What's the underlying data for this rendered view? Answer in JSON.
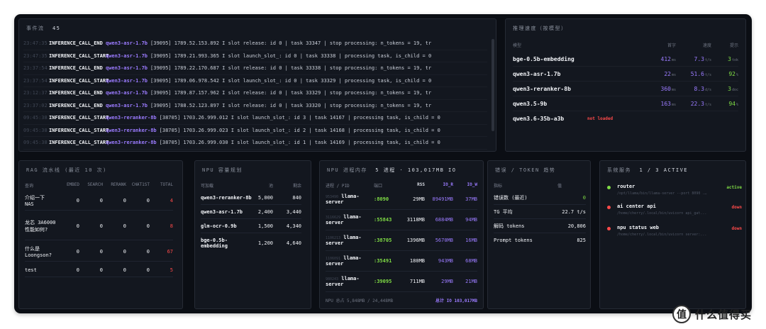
{
  "event_log": {
    "title": "事件流",
    "count": "45",
    "rows": [
      {
        "time": "23:47:35",
        "type": "INFERENCE_CALL_END",
        "model": "qwen3-asr-1.7b",
        "msg": "[39095] 1789.52.153.892 I slot release: id 0 | task 33347 | stop processing: n_tokens = 19, tr"
      },
      {
        "time": "23:47:35",
        "type": "INFERENCE_CALL_START",
        "model": "qwen3-asr-1.7b",
        "msg": "[39095] 1789.21.993.365 I slot launch_slot_: id 0 | task 33338 | processing task, is_child = 0"
      },
      {
        "time": "23:37:54",
        "type": "INFERENCE_CALL_END",
        "model": "qwen3-asr-1.7b",
        "msg": "[39095] 1789.22.170.687 I slot release: id 0 | task 33338 | stop processing: n_tokens = 19, tr"
      },
      {
        "time": "23:37:54",
        "type": "INFERENCE_CALL_START",
        "model": "qwen3-asr-1.7b",
        "msg": "[39095] 1789.06.978.542 I slot launch_slot_: id 0 | task 33329 | processing task, is_child = 0"
      },
      {
        "time": "23:12:37",
        "type": "INFERENCE_CALL_END",
        "model": "qwen3-asr-1.7b",
        "msg": "[39095] 1789.87.157.962 I slot release: id 0 | task 33329 | stop processing: n_tokens = 19, tr"
      },
      {
        "time": "23:37:02",
        "type": "INFERENCE_CALL_END",
        "model": "qwen3-asr-1.7b",
        "msg": "[39095] 1788.52.123.897 I slot release: id 0 | task 33320 | stop processing: n_tokens = 19, tr"
      },
      {
        "time": "09:45:38",
        "type": "INFERENCE_CALL_START",
        "model": "qwen3-reranker-8b",
        "msg": "[38705] 1703.26.999.012 I slot launch_slot_: id 3 | task 14167 | processing task, is_child = 0"
      },
      {
        "time": "09:45:38",
        "type": "INFERENCE_CALL_START",
        "model": "qwen3-reranker-8b",
        "msg": "[38705] 1703.26.999.023 I slot launch_slot_: id 2 | task 14168 | processing task, is_child = 0"
      },
      {
        "time": "09:45:38",
        "type": "INFERENCE_CALL_START",
        "model": "qwen3-reranker-8b",
        "msg": "[38705] 1703.26.999.030 I slot launch_slot_: id 1 | task 14169 | processing task, is_child = 0"
      }
    ]
  },
  "tg_panel": {
    "title": "推理速度（按模型）",
    "headers": [
      "模型",
      "首字",
      "速度",
      "提示"
    ],
    "rows": [
      {
        "name": "bge-0.5b-embedding",
        "ms": "412",
        "ms_unit": "ms",
        "ts": "7.3",
        "ts_unit": "t/s",
        "tk": "3",
        "tk_unit": "tok"
      },
      {
        "name": "qwen3-asr-1.7b",
        "ms": "22",
        "ms_unit": "ms",
        "ts": "51.6",
        "ts_unit": "t/s",
        "tk": "92",
        "tk_unit": "%"
      },
      {
        "name": "qwen3-reranker-8b",
        "ms": "360",
        "ms_unit": "ms",
        "ts": "8.3",
        "ts_unit": "d/s",
        "tk": "3",
        "tk_unit": "doc"
      },
      {
        "name": "qwen3.5-9b",
        "ms": "163",
        "ms_unit": "ms",
        "ts": "22.3",
        "ts_unit": "t/s",
        "tk": "94",
        "tk_unit": "%"
      },
      {
        "name": "qwen3.6-35b-a3b",
        "status": "not loaded"
      }
    ]
  },
  "rag_panel": {
    "title": "RAG 流水线 (最近 10 次)",
    "headers": [
      "查询",
      "EMBED",
      "SEARCH",
      "RERANK",
      "CHAT1ST",
      "TOTAL"
    ],
    "rows": [
      {
        "q": "介绍一下 NAS",
        "v": [
          "0",
          "0",
          "0",
          "0"
        ],
        "total": "4"
      },
      {
        "q": "龙芯 3A6000 性能如何?",
        "v": [
          "0",
          "0",
          "0",
          "0"
        ],
        "total": "8"
      },
      {
        "q": "什么是 Loongson?",
        "v": [
          "0",
          "0",
          "0",
          "0"
        ],
        "total": "67"
      },
      {
        "q": "test",
        "v": [
          "0",
          "0",
          "0",
          "0"
        ],
        "total": "5"
      }
    ]
  },
  "npu_panel": {
    "title": "NPU 容量规划",
    "headers": [
      "可加载",
      "池",
      "剩余"
    ],
    "rows": [
      {
        "name": "qwen3-reranker-8b",
        "a": "5,000",
        "b": "840"
      },
      {
        "name": "qwen3-asr-1.7b",
        "a": "2,400",
        "b": "3,440"
      },
      {
        "name": "glm-ocr-0.9b",
        "a": "1,500",
        "b": "4,340"
      },
      {
        "name": "bge-0.5b-embedding",
        "a": "1,200",
        "b": "4,640"
      }
    ]
  },
  "proc_panel": {
    "title": "NPU 进程内存",
    "subtitle": "5 进程 · 103,017MB IO",
    "headers": [
      "进程 / PID",
      "端口",
      "RSS",
      "IO_R",
      "IO_W"
    ],
    "rows": [
      {
        "pid": "953490",
        "name": "llama-server",
        "port": ":8090",
        "rss": "29MB",
        "ior": "89491MB",
        "iow": "37MB"
      },
      {
        "pid": "3116629",
        "name": "llama-server",
        "port": ":55843",
        "rss": "3118MB",
        "ior": "6884MB",
        "iow": "94MB"
      },
      {
        "pid": "1106213",
        "name": "llama-server",
        "port": ":38705",
        "rss": "1396MB",
        "ior": "5670MB",
        "iow": "16MB"
      },
      {
        "pid": "1106091",
        "name": "llama-server",
        "port": ":35491",
        "rss": "180MB",
        "ior": "943MB",
        "iow": "68MB"
      },
      {
        "pid": "980243",
        "name": "llama-server",
        "port": ":39095",
        "rss": "711MB",
        "ior": "29MB",
        "iow": "21MB"
      }
    ],
    "footer_left": "NPU 总占 5,848MB / 24,448MB",
    "footer_right": "总计 IO 103,017MB"
  },
  "tok_panel": {
    "title": "错误 / TOKEN 趋势",
    "headers": [
      "指标",
      "值"
    ],
    "rows": [
      {
        "k": "错误数 (最近)",
        "v": "0"
      },
      {
        "k": "TG 平均",
        "v": "22.7 t/s"
      },
      {
        "k": "解码 tokens",
        "v": "20,806"
      },
      {
        "k": "Prompt tokens",
        "v": "825"
      }
    ]
  },
  "sys_panel": {
    "title": "系统服务",
    "count": "1 / 3 ACTIVE",
    "services": [
      {
        "name": "router",
        "path": "/opt/llama/bin/llama-server --port 8090 ...",
        "status": "active",
        "color": "#7fdc45"
      },
      {
        "name": "ai center api",
        "path": "/home/cherry/.local/bin/uvicorn api_gat...",
        "status": "down",
        "color": "#ff4a4a"
      },
      {
        "name": "npu status web",
        "path": "/home/cherry/.local/bin/uvicorn server:...",
        "status": "down",
        "color": "#ff4a4a"
      }
    ]
  },
  "watermark": {
    "badge": "值",
    "text": "什么值得买"
  }
}
